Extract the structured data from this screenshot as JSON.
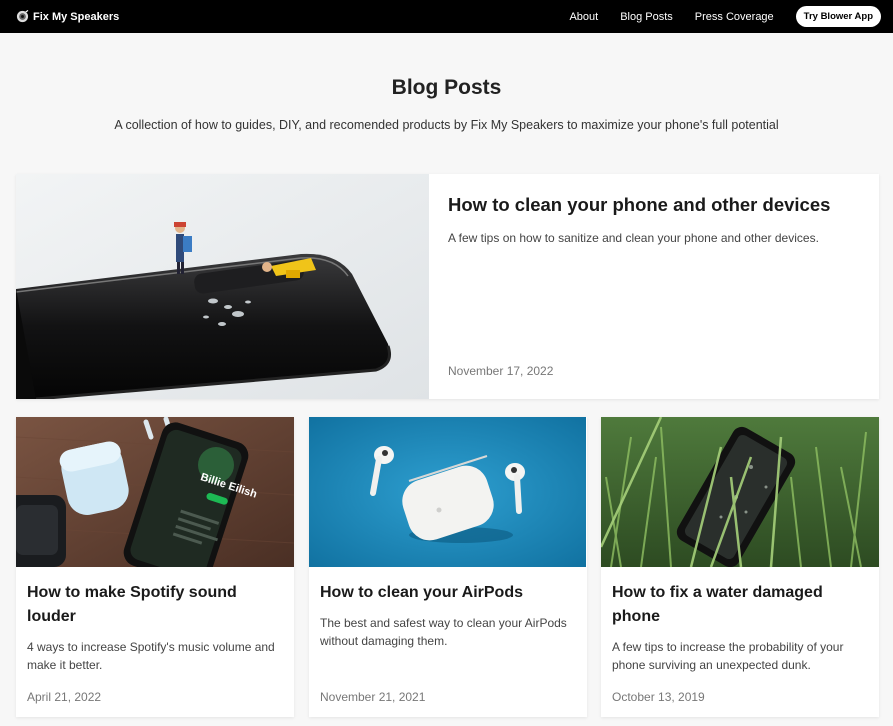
{
  "nav": {
    "brand": "Fix My Speakers",
    "links": [
      "About",
      "Blog Posts",
      "Press Coverage"
    ],
    "cta": "Try Blower App"
  },
  "page": {
    "title": "Blog Posts",
    "subtitle": "A collection of how to guides, DIY, and recomended products by Fix My Speakers to maximize your phone's full potential"
  },
  "featured": {
    "title": "How to clean your phone and other devices",
    "description": "A few tips on how to sanitize and clean your phone and other devices.",
    "date": "November 17, 2022"
  },
  "posts": [
    {
      "title": "How to make Spotify sound louder",
      "description": "4 ways to increase Spotify's music volume and make it better.",
      "date": "April 21, 2022"
    },
    {
      "title": "How to clean your AirPods",
      "description": "The best and safest way to clean your AirPods without damaging them.",
      "date": "November 21, 2021"
    },
    {
      "title": "How to fix a water damaged phone",
      "description": "A few tips to increase the probability of your phone surviving an unexpected dunk.",
      "date": "October 13, 2019"
    }
  ],
  "images": {
    "spotify_screen_text": "Billie Eilish"
  }
}
